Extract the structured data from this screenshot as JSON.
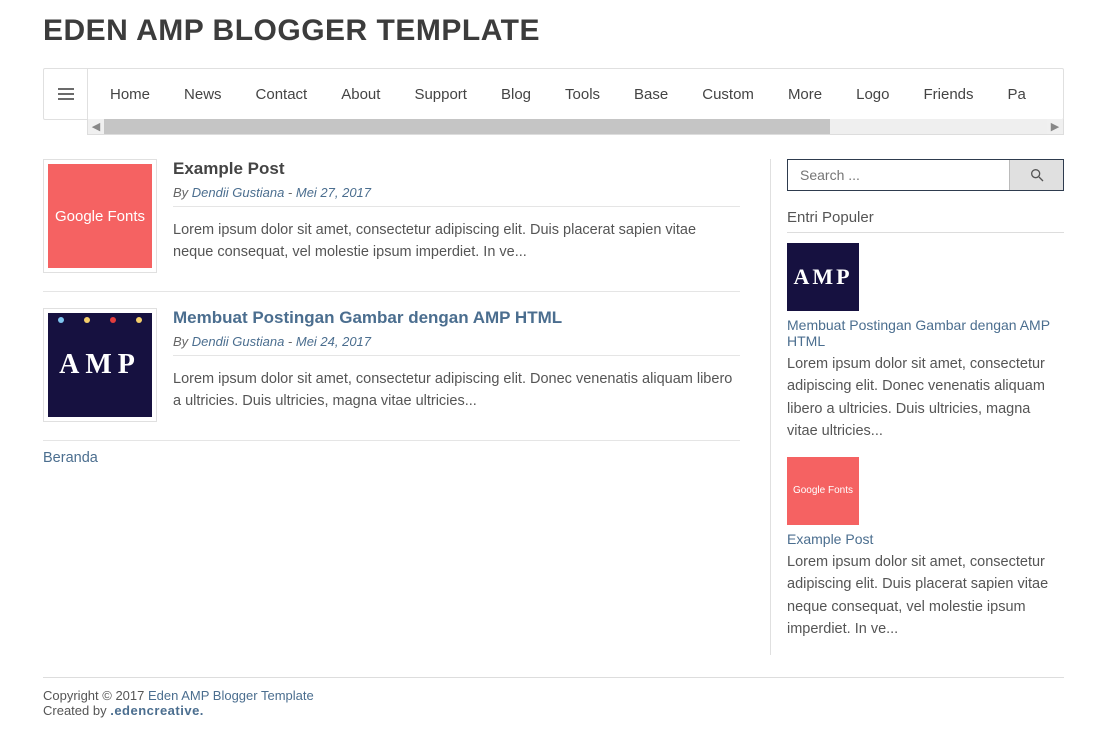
{
  "site": {
    "title": "EDEN AMP BLOGGER TEMPLATE"
  },
  "nav": {
    "items": [
      "Home",
      "News",
      "Contact",
      "About",
      "Support",
      "Blog",
      "Tools",
      "Base",
      "Custom",
      "More",
      "Logo",
      "Friends",
      "Pa"
    ]
  },
  "posts": [
    {
      "thumb_type": "red",
      "thumb_text": "Google Fonts",
      "title": "Example Post",
      "title_link": false,
      "by_label": "By ",
      "author": "Dendii Gustiana",
      "sep": " - ",
      "date": "Mei 27, 2017",
      "excerpt": "Lorem ipsum dolor sit amet, consectetur adipiscing elit. Duis placerat sapien vitae neque consequat, vel molestie ipsum imperdiet. In ve..."
    },
    {
      "thumb_type": "amp",
      "thumb_text": "AMP",
      "title": "Membuat Postingan Gambar dengan AMP HTML",
      "title_link": true,
      "by_label": "By ",
      "author": "Dendii Gustiana",
      "sep": " - ",
      "date": "Mei 24, 2017",
      "excerpt": "Lorem ipsum dolor sit amet, consectetur adipiscing elit. Donec venenatis aliquam libero a ultricies. Duis ultricies, magna vitae ultricies..."
    }
  ],
  "home_link": "Beranda",
  "sidebar": {
    "search_placeholder": "Search ...",
    "popular_title": "Entri Populer",
    "popular": [
      {
        "thumb_type": "amp",
        "thumb_text": "AMP",
        "title": "Membuat Postingan Gambar dengan AMP HTML",
        "excerpt": "Lorem ipsum dolor sit amet, consectetur adipiscing elit. Donec venenatis aliquam libero a ultricies. Duis ultricies, magna vitae ultricies..."
      },
      {
        "thumb_type": "red",
        "thumb_text": "Google Fonts",
        "title": "Example Post",
        "excerpt": "Lorem ipsum dolor sit amet, consectetur adipiscing elit. Duis placerat sapien vitae neque consequat, vel molestie ipsum imperdiet. In ve..."
      }
    ]
  },
  "footer": {
    "copyright_prefix": "Copyright © 2017 ",
    "site_link": "Eden AMP Blogger Template",
    "created_by": "Created by ",
    "brand": ".edencreative."
  }
}
